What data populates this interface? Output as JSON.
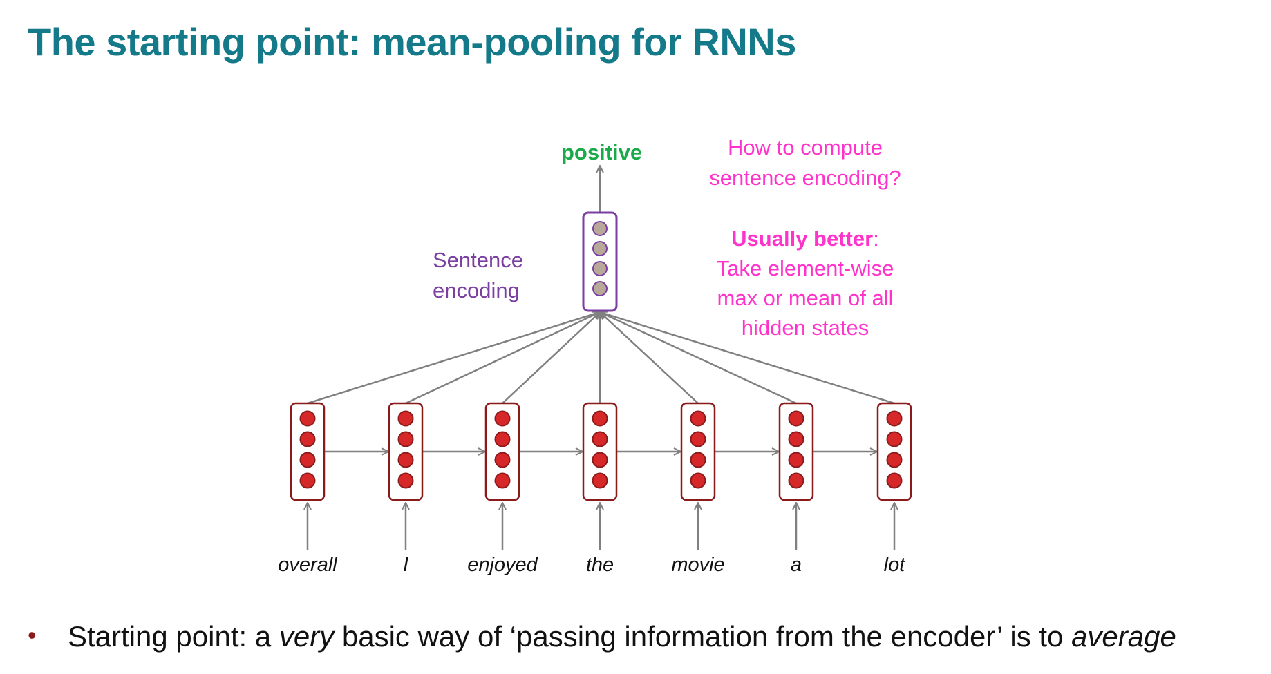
{
  "title": "The starting point: mean-pooling for RNNs",
  "diagram": {
    "output_label": "positive",
    "encoding_label_line1": "Sentence",
    "encoding_label_line2": "encoding",
    "question_line1": "How to compute",
    "question_line2": "sentence encoding?",
    "answer_bold": "Usually better",
    "answer_colon": ":",
    "answer_line1": "Take element-wise",
    "answer_line2": "max or mean of all",
    "answer_line3": "hidden states",
    "words": [
      "overall",
      "I",
      "enjoyed",
      "the",
      "movie",
      "a",
      "lot"
    ],
    "colors": {
      "title": "#147a8a",
      "hidden_state_fill": "#d62828",
      "hidden_state_border": "#8b1a1a",
      "encoding_fill": "#b8a89a",
      "encoding_border": "#7a3fa0",
      "positive": "#1aaa4a",
      "annotation": "#ff33cc",
      "arrows": "#808080"
    }
  },
  "bullet": {
    "marker": "•",
    "text_before": "Starting point: a ",
    "em1": "very",
    "text_middle": " basic way of ‘passing information from the encoder’ is to ",
    "em2": "average"
  }
}
